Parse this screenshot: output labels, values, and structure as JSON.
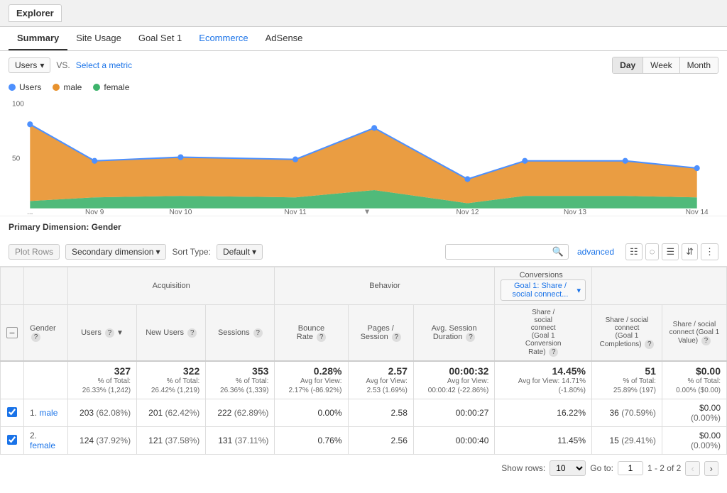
{
  "header": {
    "title": "Explorer"
  },
  "tabs": [
    {
      "label": "Summary",
      "active": true,
      "type": "normal"
    },
    {
      "label": "Site Usage",
      "active": false,
      "type": "normal"
    },
    {
      "label": "Goal Set 1",
      "active": false,
      "type": "normal"
    },
    {
      "label": "Ecommerce",
      "active": false,
      "type": "link"
    },
    {
      "label": "AdSense",
      "active": false,
      "type": "normal"
    }
  ],
  "controls": {
    "metric": "Users",
    "vs_label": "VS.",
    "select_metric": "Select a metric",
    "time_buttons": [
      "Day",
      "Week",
      "Month"
    ],
    "active_time": "Day"
  },
  "legend": [
    {
      "label": "Users",
      "color": "#4d90fe"
    },
    {
      "label": "male",
      "color": "#f39c12"
    },
    {
      "label": "female",
      "color": "#2ecc71"
    }
  ],
  "chart": {
    "y_label": "100",
    "y_mid": "50",
    "x_labels": [
      "...",
      "Nov 9",
      "Nov 10",
      "Nov 11",
      "Nov 12",
      "Nov 13",
      "Nov 14"
    ],
    "colors": {
      "users": "#4d90fe",
      "male": "#e8922e",
      "female": "#3db36b"
    }
  },
  "primary_dimension": {
    "label": "Primary Dimension:",
    "value": "Gender"
  },
  "table_controls": {
    "plot_rows": "Plot Rows",
    "secondary_dimension": "Secondary dimension",
    "sort_type_label": "Sort Type:",
    "sort_type": "Default",
    "search_placeholder": "",
    "advanced": "advanced"
  },
  "table": {
    "group_headers": [
      "Acquisition",
      "Behavior",
      "Conversions",
      "Goal 1: Share / social connect..."
    ],
    "col_headers": [
      {
        "label": "Gender",
        "help": true
      },
      {
        "label": "Users",
        "help": true,
        "sort": true
      },
      {
        "label": "New Users",
        "help": true
      },
      {
        "label": "Sessions",
        "help": true
      },
      {
        "label": "Bounce Rate",
        "help": true
      },
      {
        "label": "Pages / Session",
        "help": true
      },
      {
        "label": "Avg. Session Duration",
        "help": true
      },
      {
        "label": "Share / social connect (Goal 1 Conversion Rate)",
        "help": true
      },
      {
        "label": "Share / social connect (Goal 1 Completions)",
        "help": true
      },
      {
        "label": "Share / social connect (Goal 1 Value)",
        "help": true
      }
    ],
    "total_row": {
      "label": "",
      "users": "327",
      "users_sub": "% of Total: 26.33% (1,242)",
      "new_users": "322",
      "new_users_sub": "% of Total: 26.42% (1,219)",
      "sessions": "353",
      "sessions_sub": "% of Total: 26.36% (1,339)",
      "bounce_rate": "0.28%",
      "bounce_sub": "Avg for View: 2.17% (-86.92%)",
      "pages_session": "2.57",
      "pages_sub": "Avg for View: 2.53 (1.69%)",
      "avg_session": "00:00:32",
      "avg_sub": "Avg for View: 00:00:42 (-22.86%)",
      "conv_rate": "14.45%",
      "conv_sub": "Avg for View: 14.71% (-1.80%)",
      "completions": "51",
      "completions_sub": "% of Total: 25.89% (197)",
      "goal_value": "$0.00",
      "goal_value_sub": "% of Total: 0.00% ($0.00)"
    },
    "rows": [
      {
        "num": "1.",
        "label": "male",
        "users": "203",
        "users_pct": "(62.08%)",
        "new_users": "201",
        "new_users_pct": "(62.42%)",
        "sessions": "222",
        "sessions_pct": "(62.89%)",
        "bounce_rate": "0.00%",
        "pages_session": "2.58",
        "avg_session": "00:00:27",
        "conv_rate": "16.22%",
        "completions": "36",
        "completions_pct": "(70.59%)",
        "goal_value": "$0.00",
        "goal_value_pct": "(0.00%)"
      },
      {
        "num": "2.",
        "label": "female",
        "users": "124",
        "users_pct": "(37.92%)",
        "new_users": "121",
        "new_users_pct": "(37.58%)",
        "sessions": "131",
        "sessions_pct": "(37.11%)",
        "bounce_rate": "0.76%",
        "pages_session": "2.56",
        "avg_session": "00:00:40",
        "conv_rate": "11.45%",
        "completions": "15",
        "completions_pct": "(29.41%)",
        "goal_value": "$0.00",
        "goal_value_pct": "(0.00%)"
      }
    ]
  },
  "pagination": {
    "show_rows_label": "Show rows:",
    "rows_value": "10",
    "goto_label": "Go to:",
    "goto_value": "1",
    "page_info": "1 - 2 of 2"
  }
}
